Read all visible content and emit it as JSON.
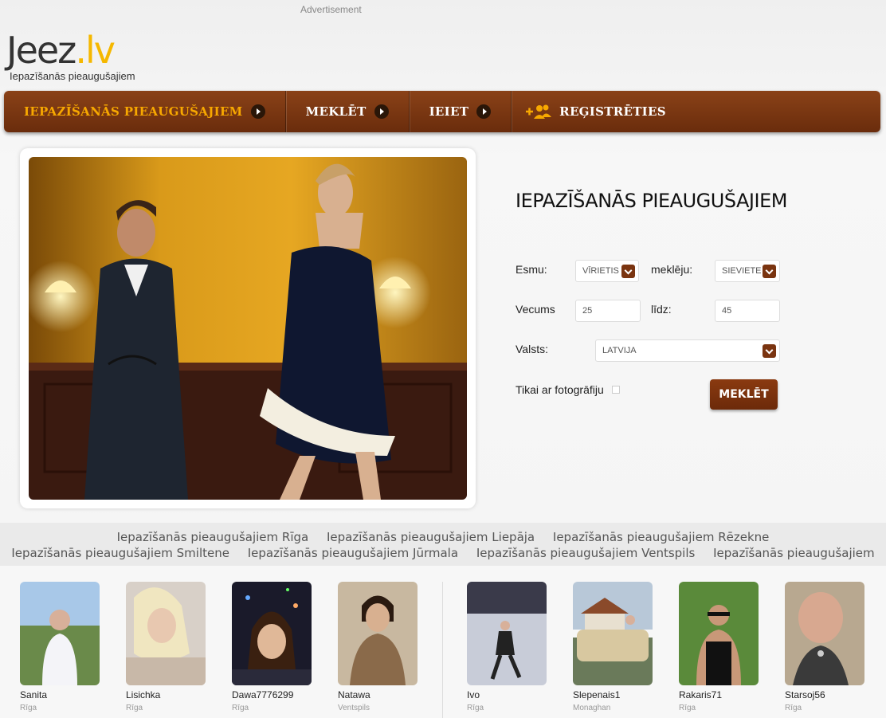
{
  "ad_label": "Advertisement",
  "logo": {
    "main": "Jeez",
    "suffix": ".lv",
    "tagline": "Iepazīšanās pieaugušajiem"
  },
  "nav": [
    {
      "label": "IEPAZĪŠANĀS PIEAUGUŠAJIEM"
    },
    {
      "label": "MEKLĒT"
    },
    {
      "label": "IEIET"
    },
    {
      "label": "REĢISTRĒTIES"
    }
  ],
  "search": {
    "title": "IEPAZĪŠANĀS PIEAUGUŠAJIEM",
    "i_am_label": "Esmu:",
    "i_am_value": "VĪRIETIS",
    "looking_label": "meklēju:",
    "looking_value": "SIEVIETE",
    "age_label": "Vecums",
    "age_from": "25",
    "to_label": "līdz:",
    "age_to": "45",
    "country_label": "Valsts:",
    "country_value": "LATVIJA",
    "photo_only_label": "Tikai ar fotogrāfiju",
    "button": "MEKLĒT"
  },
  "links_row1": [
    "Iepazīšanās pieaugušajiem Rīga",
    "Iepazīšanās pieaugušajiem Liepāja",
    "Iepazīšanās pieaugušajiem Rēzekne"
  ],
  "links_row2": [
    "Iepazīšanās pieaugušajiem Smiltene",
    "Iepazīšanās pieaugušajiem Jūrmala",
    "Iepazīšanās pieaugušajiem Ventspils",
    "Iepazīšanās pieaugušajiem"
  ],
  "profiles": [
    {
      "name": "Sanita",
      "city": "Rīga"
    },
    {
      "name": "Lisichka",
      "city": "Rīga"
    },
    {
      "name": "Dawa7776299",
      "city": "Rīga"
    },
    {
      "name": "Natawa",
      "city": "Ventspils"
    },
    {
      "name": "Ivo",
      "city": "Rīga"
    },
    {
      "name": "Slepenais1",
      "city": "Monaghan"
    },
    {
      "name": "Rakaris71",
      "city": "Rīga"
    },
    {
      "name": "Starsoj56",
      "city": "Rīga"
    }
  ],
  "colors": {
    "nav_bg": "#7a3510",
    "nav_active": "#f7a800",
    "accent": "#f5b800",
    "button": "#7a3410"
  }
}
